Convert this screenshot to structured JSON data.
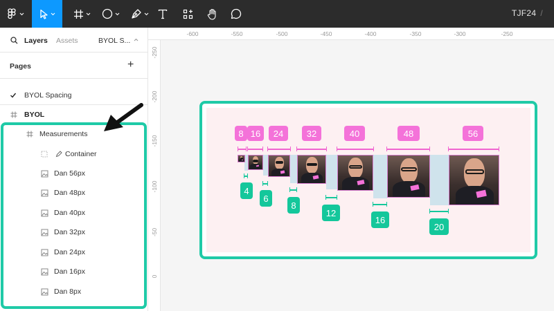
{
  "toolbar": {
    "file_title": "TJF24",
    "file_title_sep": "/",
    "tools": [
      "main-menu",
      "move",
      "frame",
      "shape",
      "pen",
      "text",
      "resources",
      "hand",
      "comment"
    ]
  },
  "panel": {
    "tabs": {
      "layers": "Layers",
      "assets": "Assets",
      "page": "BYOL S..."
    },
    "pages_heading": "Pages",
    "pages": [
      {
        "label": "BYOL Spacing",
        "checked": true
      },
      {
        "label": "BYOL",
        "checked": false
      }
    ],
    "layers": [
      {
        "label": "Measurements",
        "type": "frame"
      },
      {
        "label": "Container",
        "type": "component"
      },
      {
        "label": "Dan 56px",
        "type": "image"
      },
      {
        "label": "Dan 48px",
        "type": "image"
      },
      {
        "label": "Dan 40px",
        "type": "image"
      },
      {
        "label": "Dan 32px",
        "type": "image"
      },
      {
        "label": "Dan 24px",
        "type": "image"
      },
      {
        "label": "Dan 16px",
        "type": "image"
      },
      {
        "label": "Dan 8px",
        "type": "image"
      }
    ]
  },
  "ruler": {
    "top": [
      "-600",
      "-550",
      "-500",
      "-450",
      "-400",
      "-350",
      "-300",
      "-250"
    ],
    "left": [
      "-250",
      "-200",
      "-150",
      "-100",
      "-50",
      "0"
    ]
  },
  "canvas": {
    "image_sizes": [
      "8",
      "16",
      "24",
      "32",
      "40",
      "48",
      "56"
    ],
    "gap_sizes": [
      "4",
      "6",
      "8",
      "12",
      "16",
      "20"
    ]
  },
  "colors": {
    "accent": "#0d99ff",
    "highlight": "#1fcaa7",
    "size_label": "#f472d9",
    "gap_label": "#14c79b"
  }
}
